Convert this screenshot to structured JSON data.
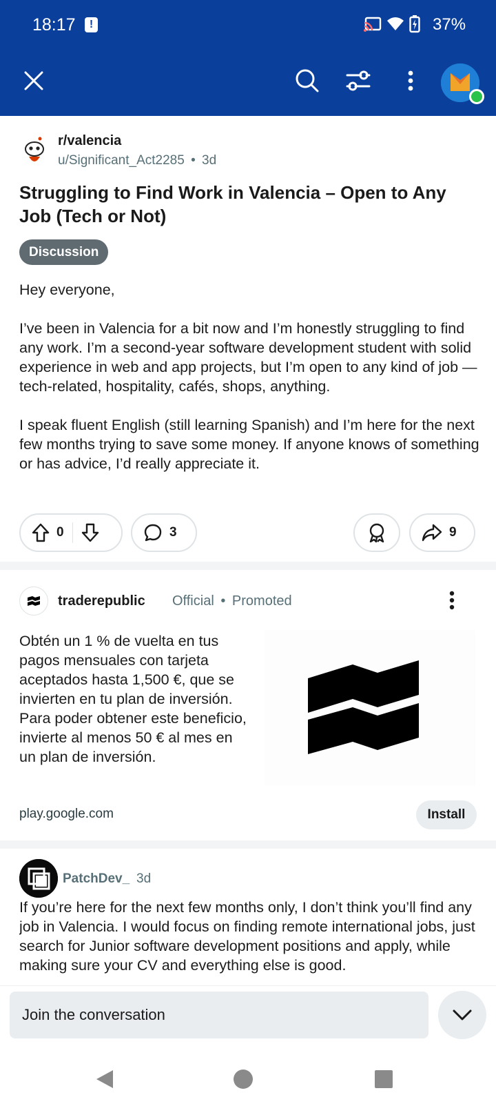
{
  "status_bar": {
    "time": "18:17",
    "battery_percent": "37%",
    "icons": [
      "cast-icon",
      "wifi-icon",
      "battery-icon"
    ]
  },
  "app_bar": {
    "icons": [
      "close-icon",
      "search-icon",
      "filter-icon",
      "more-vertical-icon",
      "user-avatar"
    ],
    "accent": "#0b3f9c"
  },
  "post": {
    "subreddit": "r/valencia",
    "author": "u/Significant_Act2285",
    "age": "3d",
    "separator": "•",
    "title": "Struggling to Find Work in Valencia – Open to Any Job (Tech or Not)",
    "flair": "Discussion",
    "body": [
      "Hey everyone,",
      "I’ve been in Valencia for a bit now and I’m honestly struggling to find any work. I’m a second-year software development student with solid experience in web and app projects, but I’m open to any kind of job — tech-related, hospitality, cafés, shops, anything.",
      "I speak fluent English (still learning Spanish) and I’m here for the next few months trying to save some money. If anyone knows of something or has advice, I’d really appreciate it."
    ],
    "actions": {
      "score": "0",
      "comments": "3",
      "shares": "9"
    }
  },
  "ad": {
    "advertiser": "traderepublic",
    "official_label": "Official",
    "separator": "•",
    "promoted_label": "Promoted",
    "text": "Obtén un 1 % de vuelta en tus pagos mensuales con tarjeta aceptados hasta 1,500 €, que se invierten en tu plan de inversión. Para poder obtener este beneficio, invierte al menos 50 € al mes en un plan de inversión.",
    "domain": "play.google.com",
    "cta": "Install"
  },
  "comment": {
    "user": "PatchDev_",
    "age": "3d",
    "body": "If you’re here for the next few months only, I don’t think you’ll find any job in Valencia. I would focus on finding remote international jobs, just search for Junior software development positions and apply, while making sure your CV and everything else is good."
  },
  "composer": {
    "placeholder": "Join the conversation"
  },
  "nav": {
    "icons": [
      "back-icon",
      "home-icon",
      "recents-icon"
    ]
  }
}
